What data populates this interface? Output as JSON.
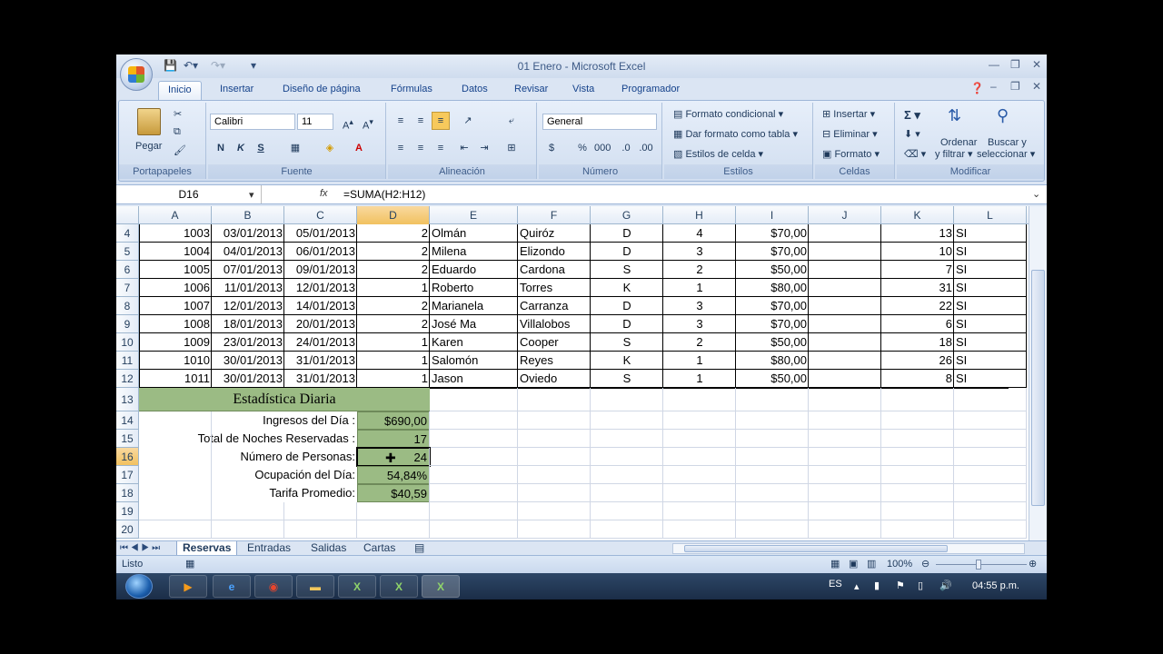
{
  "window": {
    "title": "01 Enero - Microsoft Excel"
  },
  "tabs": [
    "Inicio",
    "Insertar",
    "Diseño de página",
    "Fórmulas",
    "Datos",
    "Revisar",
    "Vista",
    "Programador"
  ],
  "ribbon": {
    "portapapeles": {
      "label": "Portapapeles",
      "paste": "Pegar"
    },
    "fuente": {
      "label": "Fuente",
      "font": "Calibri",
      "size": "11",
      "bold": "N",
      "italic": "K",
      "underline": "S"
    },
    "alineacion": {
      "label": "Alineación"
    },
    "numero": {
      "label": "Número",
      "format": "General"
    },
    "estilos": {
      "label": "Estilos",
      "cond": "Formato condicional",
      "table": "Dar formato como tabla",
      "cell": "Estilos de celda"
    },
    "celdas": {
      "label": "Celdas",
      "insert": "Insertar",
      "delete": "Eliminar",
      "format": "Formato"
    },
    "modificar": {
      "label": "Modificar",
      "sort1": "Ordenar",
      "sort2": "y filtrar",
      "find1": "Buscar y",
      "find2": "seleccionar"
    }
  },
  "formula_bar": {
    "name_box": "D16",
    "formula": "=SUMA(H2:H12)"
  },
  "columns": [
    "A",
    "B",
    "C",
    "D",
    "E",
    "F",
    "G",
    "H",
    "I",
    "J",
    "K",
    "L"
  ],
  "rows": [
    {
      "n": "4",
      "A": "1003",
      "B": "03/01/2013",
      "C": "05/01/2013",
      "D": "2",
      "E": "Olmán",
      "F": "Quiróz",
      "G": "D",
      "H": "4",
      "I": "$70,00",
      "K": "13",
      "L": "SI"
    },
    {
      "n": "5",
      "A": "1004",
      "B": "04/01/2013",
      "C": "06/01/2013",
      "D": "2",
      "E": "Milena",
      "F": "Elizondo",
      "G": "D",
      "H": "3",
      "I": "$70,00",
      "K": "10",
      "L": "SI"
    },
    {
      "n": "6",
      "A": "1005",
      "B": "07/01/2013",
      "C": "09/01/2013",
      "D": "2",
      "E": "Eduardo",
      "F": "Cardona",
      "G": "S",
      "H": "2",
      "I": "$50,00",
      "K": "7",
      "L": "SI"
    },
    {
      "n": "7",
      "A": "1006",
      "B": "11/01/2013",
      "C": "12/01/2013",
      "D": "1",
      "E": "Roberto",
      "F": "Torres",
      "G": "K",
      "H": "1",
      "I": "$80,00",
      "K": "31",
      "L": "SI"
    },
    {
      "n": "8",
      "A": "1007",
      "B": "12/01/2013",
      "C": "14/01/2013",
      "D": "2",
      "E": "Marianela",
      "F": "Carranza",
      "G": "D",
      "H": "3",
      "I": "$70,00",
      "K": "22",
      "L": "SI"
    },
    {
      "n": "9",
      "A": "1008",
      "B": "18/01/2013",
      "C": "20/01/2013",
      "D": "2",
      "E": "José Ma",
      "F": "Villalobos",
      "G": "D",
      "H": "3",
      "I": "$70,00",
      "K": "6",
      "L": "SI"
    },
    {
      "n": "10",
      "A": "1009",
      "B": "23/01/2013",
      "C": "24/01/2013",
      "D": "1",
      "E": "Karen",
      "F": "Cooper",
      "G": "S",
      "H": "2",
      "I": "$50,00",
      "K": "18",
      "L": "SI"
    },
    {
      "n": "11",
      "A": "1010",
      "B": "30/01/2013",
      "C": "31/01/2013",
      "D": "1",
      "E": "Salomón",
      "F": "Reyes",
      "G": "K",
      "H": "1",
      "I": "$80,00",
      "K": "26",
      "L": "SI"
    },
    {
      "n": "12",
      "A": "1011",
      "B": "30/01/2013",
      "C": "31/01/2013",
      "D": "1",
      "E": "Jason",
      "F": "Oviedo",
      "G": "S",
      "H": "1",
      "I": "$50,00",
      "K": "8",
      "L": "SI"
    }
  ],
  "stats": {
    "title": "Estadística Diaria",
    "rows": [
      {
        "n": "14",
        "label": "Ingresos del Día :",
        "value": "$690,00"
      },
      {
        "n": "15",
        "label": "Total de Noches Reservadas :",
        "value": "17"
      },
      {
        "n": "16",
        "label": "Número de Personas:",
        "value": "24"
      },
      {
        "n": "17",
        "label": "Ocupación del Día:",
        "value": "54,84%"
      },
      {
        "n": "18",
        "label": "Tarifa Promedio:",
        "value": "$40,59"
      }
    ]
  },
  "extra_rows": [
    "13",
    "19",
    "20"
  ],
  "sheets": [
    "Reservas",
    "Entradas",
    "Salidas",
    "Cartas"
  ],
  "status": {
    "mode": "Listo",
    "zoom": "100%"
  },
  "taskbar": {
    "lang": "ES",
    "time": "04:55 p.m."
  }
}
